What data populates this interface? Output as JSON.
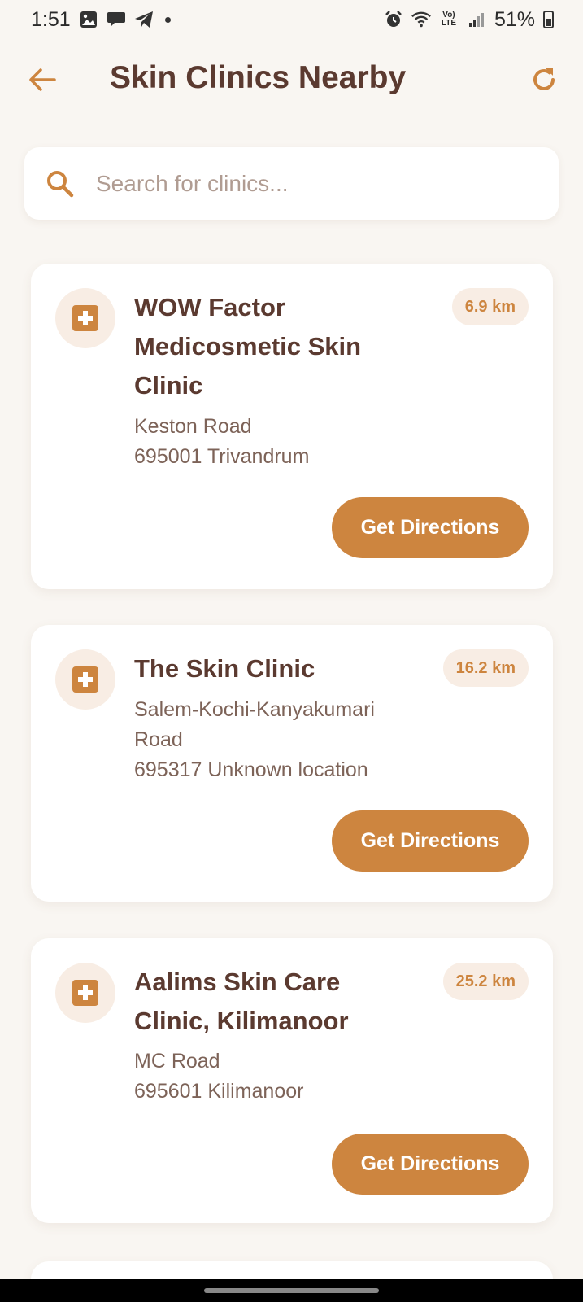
{
  "status": {
    "time": "1:51",
    "battery": "51%",
    "lte": "Vo) LTE"
  },
  "header": {
    "title": "Skin Clinics Nearby"
  },
  "search": {
    "placeholder": "Search for clinics..."
  },
  "clinics": [
    {
      "name": "WOW Factor Medicosmetic Skin Clinic",
      "distance": "6.9 km",
      "address_line1": "Keston Road",
      "address_line2": "695001 Trivandrum",
      "button": "Get Directions"
    },
    {
      "name": "The Skin Clinic",
      "distance": "16.2 km",
      "address_line1": "Salem-Kochi-Kanyakumari Road",
      "address_line2": "695317 Unknown location",
      "button": "Get Directions"
    },
    {
      "name": "Aalims Skin Care Clinic, Kilimanoor",
      "distance": "25.2 km",
      "address_line1": "MC Road",
      "address_line2": "695601 Kilimanoor",
      "button": "Get Directions"
    }
  ],
  "icons": {
    "back": "arrow-left-icon",
    "refresh": "refresh-icon",
    "search": "search-icon",
    "clinic": "medical-cross-icon"
  },
  "colors": {
    "accent": "#cd853f",
    "title": "#5b3a30",
    "background": "#f9f6f2"
  }
}
